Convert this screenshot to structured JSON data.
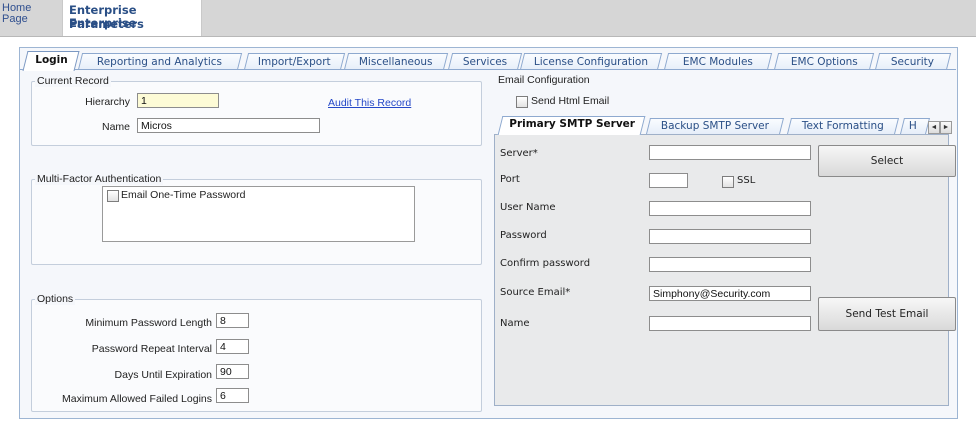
{
  "header": {
    "home_link": "Home Page",
    "title_line1": "Enterprise Parameters",
    "title_line2": "Enterprise"
  },
  "tabs": [
    {
      "label": "Login",
      "active": true
    },
    {
      "label": "Reporting and Analytics"
    },
    {
      "label": "Import/Export"
    },
    {
      "label": "Miscellaneous"
    },
    {
      "label": "Services"
    },
    {
      "label": "License Configuration"
    },
    {
      "label": "EMC Modules"
    },
    {
      "label": "EMC Options"
    },
    {
      "label": "Security"
    }
  ],
  "current_record": {
    "legend": "Current Record",
    "hierarchy_label": "Hierarchy",
    "hierarchy_value": "1",
    "audit_link": "Audit This Record",
    "name_label": "Name",
    "name_value": "Micros"
  },
  "mfa": {
    "legend": "Multi-Factor Authentication",
    "email_otp_label": "Email One-Time Password"
  },
  "options": {
    "legend": "Options",
    "fields": [
      {
        "label": "Minimum Password Length",
        "value": "8"
      },
      {
        "label": "Password Repeat Interval",
        "value": "4"
      },
      {
        "label": "Days Until Expiration",
        "value": "90"
      },
      {
        "label": "Maximum Allowed Failed Logins",
        "value": "6"
      }
    ]
  },
  "email_config": {
    "legend": "Email Configuration",
    "send_html_label": "Send Html Email",
    "subtabs": [
      {
        "label": "Primary SMTP Server",
        "active": true
      },
      {
        "label": "Backup SMTP Server"
      },
      {
        "label": "Text Formatting"
      },
      {
        "label": "H"
      }
    ],
    "server_label": "Server*",
    "server_value": "",
    "port_label": "Port",
    "port_value": "",
    "ssl_label": "SSL",
    "username_label": "User Name",
    "username_value": "",
    "password_label": "Password",
    "password_value": "",
    "confirm_label": "Confirm password",
    "confirm_value": "",
    "source_label": "Source Email*",
    "source_value": "Simphony@Security.com",
    "name_label": "Name",
    "name_value": "",
    "select_button": "Select",
    "send_test_button": "Send Test Email",
    "scroll_left": "◄",
    "scroll_right": "►"
  }
}
